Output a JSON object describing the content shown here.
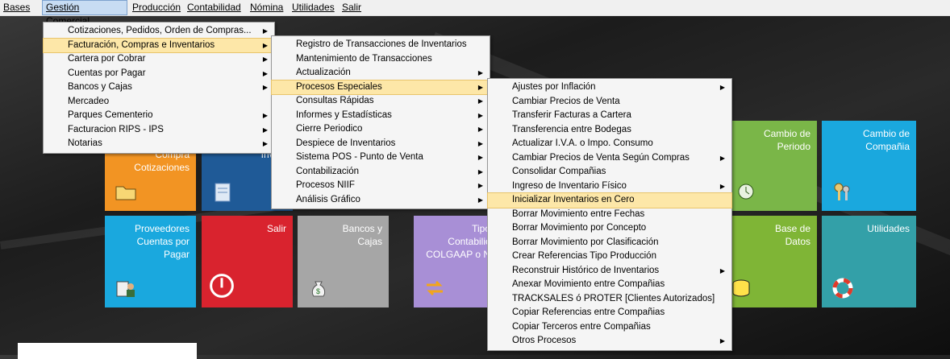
{
  "menubar": [
    {
      "label": "Bases"
    },
    {
      "label": "Gestión Comercial",
      "active": true
    },
    {
      "label": "Producción"
    },
    {
      "label": "Contabilidad"
    },
    {
      "label": "Nómina"
    },
    {
      "label": "Utilidades"
    },
    {
      "label": "Salir"
    }
  ],
  "menu1": [
    {
      "label": "Cotizaciones, Pedidos, Orden de  Compras...",
      "arrow": true
    },
    {
      "label": "Facturación, Compras e Inventarios",
      "arrow": true,
      "highlight": true
    },
    {
      "label": "Cartera por Cobrar",
      "arrow": true
    },
    {
      "label": "Cuentas por Pagar",
      "arrow": true
    },
    {
      "label": "Bancos y Cajas",
      "arrow": true
    },
    {
      "label": "Mercadeo",
      "arrow": false
    },
    {
      "label": "Parques Cementerio",
      "arrow": true
    },
    {
      "label": "Facturacion RIPS - IPS",
      "arrow": true
    },
    {
      "label": "Notarias",
      "arrow": true
    }
  ],
  "menu2": [
    {
      "label": "Registro de Transacciones de Inventarios",
      "arrow": false
    },
    {
      "label": "Mantenimiento de Transacciones",
      "arrow": false
    },
    {
      "label": "Actualización",
      "arrow": true
    },
    {
      "label": "Procesos Especiales",
      "arrow": true,
      "highlight": true
    },
    {
      "label": "Consultas Rápidas",
      "arrow": true
    },
    {
      "label": "Informes y Estadísticas",
      "arrow": true
    },
    {
      "label": "Cierre Periodico",
      "arrow": true
    },
    {
      "label": "Despiece de Inventarios",
      "arrow": true
    },
    {
      "label": "Sistema POS - Punto de Venta",
      "arrow": true
    },
    {
      "label": "Contabilización",
      "arrow": true
    },
    {
      "label": "Procesos NIIF",
      "arrow": true
    },
    {
      "label": "Análisis Gráfico",
      "arrow": true
    }
  ],
  "menu3": [
    {
      "label": "Ajustes por Inflación",
      "arrow": true
    },
    {
      "label": "Cambiar Precios de Venta",
      "arrow": false
    },
    {
      "label": "Transferir Facturas a Cartera",
      "arrow": false
    },
    {
      "label": "Transferencia entre Bodegas",
      "arrow": false
    },
    {
      "label": "Actualizar I.V.A. o Impo. Consumo",
      "arrow": false
    },
    {
      "label": "Cambiar Precios de Venta Según Compras",
      "arrow": true
    },
    {
      "label": "Consolidar Compañias",
      "arrow": false
    },
    {
      "label": "Ingreso de Inventario Físico",
      "arrow": true
    },
    {
      "label": "Inicializar Inventarios en Cero",
      "arrow": false,
      "highlight": true
    },
    {
      "label": "Borrar Movimiento entre Fechas",
      "arrow": false
    },
    {
      "label": "Borrar Movimiento por Concepto",
      "arrow": false
    },
    {
      "label": "Borrar Movimiento por Clasificación",
      "arrow": false
    },
    {
      "label": "Crear Referencias Tipo Producción",
      "arrow": false
    },
    {
      "label": "Reconstruir Histórico de Inventarios",
      "arrow": true
    },
    {
      "label": "Anexar Movimiento entre Compañias",
      "arrow": false
    },
    {
      "label": "TRACKSALES ó PROTER [Clientes Autorizados]",
      "arrow": false
    },
    {
      "label": "Copiar Referencias entre Compañias",
      "arrow": false
    },
    {
      "label": "Copiar Terceros entre Compañias",
      "arrow": false
    },
    {
      "label": "Otros Procesos",
      "arrow": true
    }
  ],
  "tiles": {
    "compra": "Compra\nCotizaciones",
    "inventa": "Inventa",
    "cambio_periodo": "Cambio de\nPeriodo",
    "cambio_compania": "Cambio de\nCompañia",
    "proveedores": "Proveedores\nCuentas por\nPagar",
    "salir": "Salir",
    "bancos": "Bancos y\nCajas",
    "tipo": "Tipo\nContabilic\nCOLGAAP o N",
    "base_datos": "Base de\nDatos",
    "utilidades": "Utilidades"
  },
  "colors": {
    "orange": "#f29423",
    "navy": "#1f5a97",
    "green": "#7ab648",
    "cyan": "#1aa8de",
    "red": "#d9232e",
    "gray": "#a6a6a6",
    "lavender": "#a88fd6",
    "lime": "#7fb536",
    "teal": "#33a0a8"
  }
}
